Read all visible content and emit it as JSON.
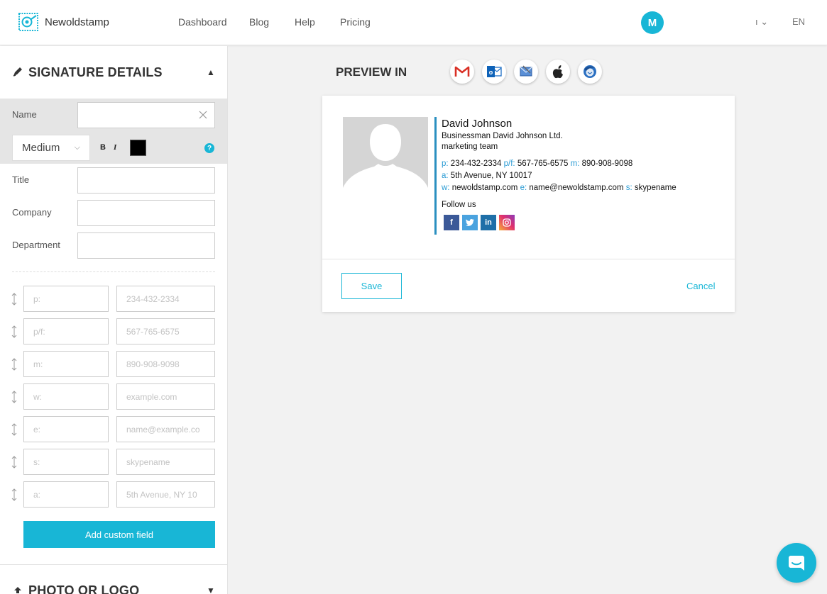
{
  "header": {
    "brand": "Newoldstamp",
    "nav": [
      "Dashboard",
      "Blog",
      "Help",
      "Pricing"
    ],
    "avatar_initial": "M",
    "account_caret": "ı ⌄",
    "language": "EN"
  },
  "sidebar": {
    "signature_details_title": "SIGNATURE DETAILS",
    "photo_logo_title": "PHOTO OR LOGO",
    "name_label": "Name",
    "name_value": "",
    "font_weight": "Medium",
    "bold_label": "B",
    "italic_label": "I",
    "text_color": "#000000",
    "help": "?",
    "title_label": "Title",
    "company_label": "Company",
    "department_label": "Department",
    "contact_fields": [
      {
        "label_placeholder": "p:",
        "value_placeholder": "234-432-2334"
      },
      {
        "label_placeholder": "p/f:",
        "value_placeholder": "567-765-6575"
      },
      {
        "label_placeholder": "m:",
        "value_placeholder": "890-908-9098"
      },
      {
        "label_placeholder": "w:",
        "value_placeholder": "example.com"
      },
      {
        "label_placeholder": "e:",
        "value_placeholder": "name@example.co"
      },
      {
        "label_placeholder": "s:",
        "value_placeholder": "skypename"
      },
      {
        "label_placeholder": "a:",
        "value_placeholder": "5th Avenue, NY 10"
      }
    ],
    "add_custom_field": "Add custom field"
  },
  "preview": {
    "label": "PREVIEW IN",
    "clients": [
      "gmail-icon",
      "outlook-icon",
      "apple-mail-icon",
      "apple-icon",
      "thunderbird-icon"
    ],
    "signature": {
      "name": "David Johnson",
      "company_line": "Businessman David Johnson Ltd.",
      "department": "marketing team",
      "p_label": "p:",
      "p_value": "234-432-2334",
      "pf_label": "p/f:",
      "pf_value": "567-765-6575",
      "m_label": "m:",
      "m_value": "890-908-9098",
      "a_label": "a:",
      "a_value": "5th Avenue, NY 10017",
      "w_label": "w:",
      "w_value": "newoldstamp.com",
      "e_label": "e:",
      "e_value": "name@newoldstamp.com",
      "s_label": "s:",
      "s_value": "skypename",
      "follow_us": "Follow us",
      "socials": [
        {
          "name": "facebook",
          "glyph": "f",
          "color": "#3b5998"
        },
        {
          "name": "twitter",
          "glyph": "t",
          "color": "#4aa3df"
        },
        {
          "name": "linkedin",
          "glyph": "in",
          "color": "#1e6fa8"
        },
        {
          "name": "instagram",
          "glyph": "ig",
          "color": "#d6366f"
        }
      ]
    },
    "save_label": "Save",
    "cancel_label": "Cancel"
  },
  "colors": {
    "accent": "#18b6d6",
    "sig_bar": "#2a8fc0",
    "sig_label": "#2a9bd4"
  }
}
